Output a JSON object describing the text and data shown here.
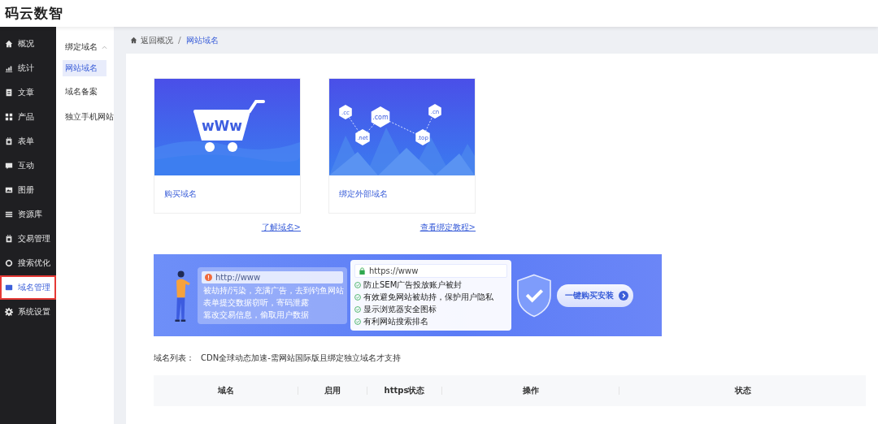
{
  "app": {
    "title": "码云数智"
  },
  "sidebar": {
    "items": [
      {
        "label": "概况",
        "selected": false
      },
      {
        "label": "统计",
        "selected": false
      },
      {
        "label": "文章",
        "selected": false
      },
      {
        "label": "产品",
        "selected": false
      },
      {
        "label": "表单",
        "selected": false
      },
      {
        "label": "互动",
        "selected": false
      },
      {
        "label": "图册",
        "selected": false
      },
      {
        "label": "资源库",
        "selected": false
      },
      {
        "label": "交易管理",
        "selected": false
      },
      {
        "label": "搜索优化",
        "selected": false
      },
      {
        "label": "域名管理",
        "selected": true
      },
      {
        "label": "系统设置",
        "selected": false
      }
    ]
  },
  "subnav": {
    "items": [
      {
        "label": "绑定域名",
        "expanded": true,
        "children": [
          {
            "label": "网站域名",
            "selected": true
          }
        ]
      },
      {
        "label": "域名备案",
        "selected": false
      },
      {
        "label": "独立手机网站",
        "selected": false
      }
    ]
  },
  "breadcrumb": {
    "separator": "/",
    "items": [
      {
        "label": "返回概况"
      },
      {
        "label": "网站域名"
      }
    ]
  },
  "cards": [
    {
      "kind": "cart",
      "art_text": "wWw",
      "title": "购买域名",
      "link": "了解域名>"
    },
    {
      "kind": "hexagons",
      "tags": [
        ".cc",
        ".com",
        ".cn",
        ".net",
        ".top"
      ],
      "title": "绑定外部域名",
      "link": "查看绑定教程>"
    }
  ],
  "banner": {
    "http_url": "http://www",
    "http_points": [
      "被劫持/污染，充满广告，去到钓鱼网站",
      "表单提交数据窃听，寄码泄露",
      "篡改交易信息，偷取用户数据"
    ],
    "https_url": "https://www",
    "https_points": [
      "防止SEM广告投放账户被封",
      "有效避免网站被劫持，保护用户隐私",
      "显示浏览器安全图标",
      "有利网站搜索排名"
    ],
    "button": "一键购买安装"
  },
  "domain_list": {
    "label": "域名列表：",
    "note": "CDN全球动态加速-需网站国际版且绑定独立域名才支持"
  },
  "table": {
    "columns": [
      "域名",
      "启用",
      "https状态",
      "操作",
      "状态"
    ]
  }
}
